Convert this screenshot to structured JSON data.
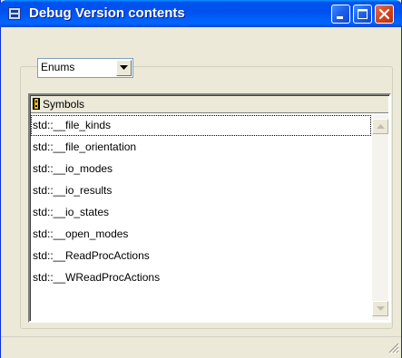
{
  "window": {
    "title": "Debug Version contents",
    "title_icon": "app-window-icon",
    "buttons": [
      {
        "name": "minimize",
        "icon": "minimize-icon"
      },
      {
        "name": "maximize",
        "icon": "maximize-icon"
      },
      {
        "name": "close",
        "icon": "close-icon"
      }
    ]
  },
  "filter": {
    "selected": "Enums",
    "dropdown_icon": "chevron-down-icon"
  },
  "symbols": {
    "header": "Symbols",
    "header_icon": "symbol-icon",
    "items": [
      "std::__file_kinds",
      "std::__file_orientation",
      "std::__io_modes",
      "std::__io_results",
      "std::__io_states",
      "std::__open_modes",
      "std::__ReadProcActions",
      "std::__WReadProcActions"
    ],
    "focused_index": 0
  },
  "colors": {
    "titlebar": "#0054e3",
    "window_face": "#ece9d8",
    "close_button": "#d3421a"
  }
}
